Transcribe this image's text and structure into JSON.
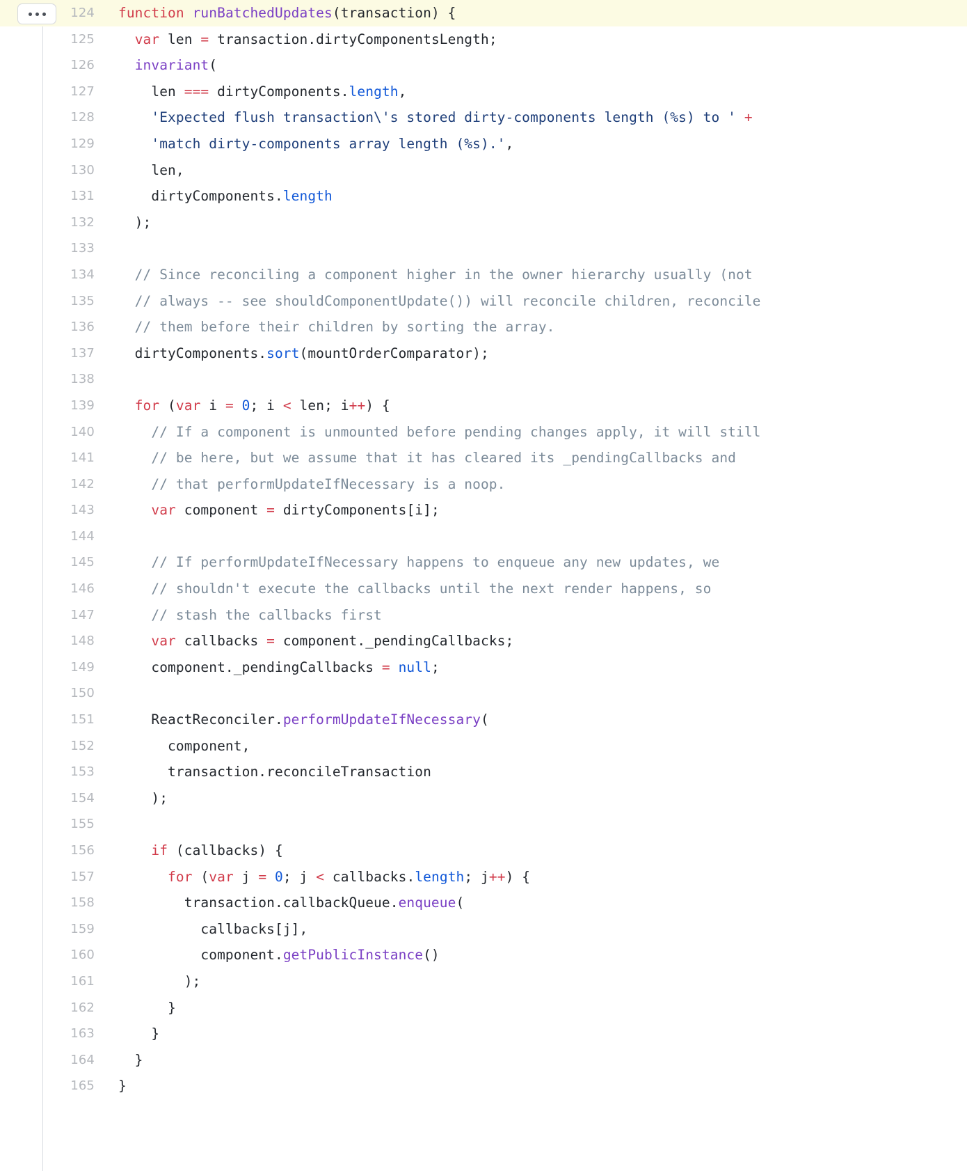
{
  "viewer": {
    "expand_button_label": "...",
    "first_line": 124,
    "last_line": 165,
    "highlighted_line": 124,
    "colors": {
      "background": "#ffffff",
      "highlight": "#fcfbe3",
      "gutter_rule": "#d8dbe0",
      "line_number": "#b5b8bd",
      "keyword": "#d13b4a",
      "function_name": "#7a3fc4",
      "string": "#1f3f7a",
      "comment": "#7c8b99",
      "property": "#1158d8",
      "plain": "#24282e"
    }
  },
  "lines": [
    {
      "n": "124",
      "highlighted": true,
      "tokens": [
        {
          "t": "function",
          "c": "t-kw"
        },
        {
          "t": " ",
          "c": "t-pln"
        },
        {
          "t": "runBatchedUpdates",
          "c": "t-fn"
        },
        {
          "t": "(transaction) {",
          "c": "t-pln"
        }
      ]
    },
    {
      "n": "125",
      "tokens": [
        {
          "t": "  ",
          "c": "t-pln"
        },
        {
          "t": "var",
          "c": "t-kw"
        },
        {
          "t": " len ",
          "c": "t-pln"
        },
        {
          "t": "=",
          "c": "t-op"
        },
        {
          "t": " transaction.dirtyComponentsLength;",
          "c": "t-pln"
        }
      ]
    },
    {
      "n": "126",
      "tokens": [
        {
          "t": "  ",
          "c": "t-pln"
        },
        {
          "t": "invariant",
          "c": "t-fn"
        },
        {
          "t": "(",
          "c": "t-pln"
        }
      ]
    },
    {
      "n": "127",
      "tokens": [
        {
          "t": "    len ",
          "c": "t-pln"
        },
        {
          "t": "===",
          "c": "t-op"
        },
        {
          "t": " dirtyComponents.",
          "c": "t-pln"
        },
        {
          "t": "length",
          "c": "t-prop"
        },
        {
          "t": ",",
          "c": "t-pln"
        }
      ]
    },
    {
      "n": "128",
      "tokens": [
        {
          "t": "    ",
          "c": "t-pln"
        },
        {
          "t": "'Expected flush transaction\\'s stored dirty-components length (%s) to '",
          "c": "t-str"
        },
        {
          "t": " ",
          "c": "t-pln"
        },
        {
          "t": "+",
          "c": "t-op"
        }
      ]
    },
    {
      "n": "129",
      "tokens": [
        {
          "t": "    ",
          "c": "t-pln"
        },
        {
          "t": "'match dirty-components array length (%s).'",
          "c": "t-str"
        },
        {
          "t": ",",
          "c": "t-pln"
        }
      ]
    },
    {
      "n": "130",
      "tokens": [
        {
          "t": "    len,",
          "c": "t-pln"
        }
      ]
    },
    {
      "n": "131",
      "tokens": [
        {
          "t": "    dirtyComponents.",
          "c": "t-pln"
        },
        {
          "t": "length",
          "c": "t-prop"
        }
      ]
    },
    {
      "n": "132",
      "tokens": [
        {
          "t": "  );",
          "c": "t-pln"
        }
      ]
    },
    {
      "n": "133",
      "tokens": [
        {
          "t": "",
          "c": "t-pln"
        }
      ]
    },
    {
      "n": "134",
      "tokens": [
        {
          "t": "  // Since reconciling a component higher in the owner hierarchy usually (not",
          "c": "t-com"
        }
      ]
    },
    {
      "n": "135",
      "tokens": [
        {
          "t": "  // always -- see shouldComponentUpdate()) will reconcile children, reconcile",
          "c": "t-com"
        }
      ]
    },
    {
      "n": "136",
      "tokens": [
        {
          "t": "  // them before their children by sorting the array.",
          "c": "t-com"
        }
      ]
    },
    {
      "n": "137",
      "tokens": [
        {
          "t": "  dirtyComponents.",
          "c": "t-pln"
        },
        {
          "t": "sort",
          "c": "t-prop"
        },
        {
          "t": "(mountOrderComparator);",
          "c": "t-pln"
        }
      ]
    },
    {
      "n": "138",
      "tokens": [
        {
          "t": "",
          "c": "t-pln"
        }
      ]
    },
    {
      "n": "139",
      "tokens": [
        {
          "t": "  ",
          "c": "t-pln"
        },
        {
          "t": "for",
          "c": "t-kw"
        },
        {
          "t": " (",
          "c": "t-pln"
        },
        {
          "t": "var",
          "c": "t-kw"
        },
        {
          "t": " i ",
          "c": "t-pln"
        },
        {
          "t": "=",
          "c": "t-op"
        },
        {
          "t": " ",
          "c": "t-pln"
        },
        {
          "t": "0",
          "c": "t-num"
        },
        {
          "t": "; i ",
          "c": "t-pln"
        },
        {
          "t": "<",
          "c": "t-op"
        },
        {
          "t": " len; i",
          "c": "t-pln"
        },
        {
          "t": "++",
          "c": "t-op"
        },
        {
          "t": ") {",
          "c": "t-pln"
        }
      ]
    },
    {
      "n": "140",
      "tokens": [
        {
          "t": "    // If a component is unmounted before pending changes apply, it will still",
          "c": "t-com"
        }
      ]
    },
    {
      "n": "141",
      "tokens": [
        {
          "t": "    // be here, but we assume that it has cleared its _pendingCallbacks and",
          "c": "t-com"
        }
      ]
    },
    {
      "n": "142",
      "tokens": [
        {
          "t": "    // that performUpdateIfNecessary is a noop.",
          "c": "t-com"
        }
      ]
    },
    {
      "n": "143",
      "tokens": [
        {
          "t": "    ",
          "c": "t-pln"
        },
        {
          "t": "var",
          "c": "t-kw"
        },
        {
          "t": " component ",
          "c": "t-pln"
        },
        {
          "t": "=",
          "c": "t-op"
        },
        {
          "t": " dirtyComponents[i];",
          "c": "t-pln"
        }
      ]
    },
    {
      "n": "144",
      "tokens": [
        {
          "t": "",
          "c": "t-pln"
        }
      ]
    },
    {
      "n": "145",
      "tokens": [
        {
          "t": "    // If performUpdateIfNecessary happens to enqueue any new updates, we",
          "c": "t-com"
        }
      ]
    },
    {
      "n": "146",
      "tokens": [
        {
          "t": "    // shouldn't execute the callbacks until the next render happens, so",
          "c": "t-com"
        }
      ]
    },
    {
      "n": "147",
      "tokens": [
        {
          "t": "    // stash the callbacks first",
          "c": "t-com"
        }
      ]
    },
    {
      "n": "148",
      "tokens": [
        {
          "t": "    ",
          "c": "t-pln"
        },
        {
          "t": "var",
          "c": "t-kw"
        },
        {
          "t": " callbacks ",
          "c": "t-pln"
        },
        {
          "t": "=",
          "c": "t-op"
        },
        {
          "t": " component._pendingCallbacks;",
          "c": "t-pln"
        }
      ]
    },
    {
      "n": "149",
      "tokens": [
        {
          "t": "    component._pendingCallbacks ",
          "c": "t-pln"
        },
        {
          "t": "=",
          "c": "t-op"
        },
        {
          "t": " ",
          "c": "t-pln"
        },
        {
          "t": "null",
          "c": "t-num"
        },
        {
          "t": ";",
          "c": "t-pln"
        }
      ]
    },
    {
      "n": "150",
      "tokens": [
        {
          "t": "",
          "c": "t-pln"
        }
      ]
    },
    {
      "n": "151",
      "tokens": [
        {
          "t": "    ReactReconciler.",
          "c": "t-pln"
        },
        {
          "t": "performUpdateIfNecessary",
          "c": "t-fn"
        },
        {
          "t": "(",
          "c": "t-pln"
        }
      ]
    },
    {
      "n": "152",
      "tokens": [
        {
          "t": "      component,",
          "c": "t-pln"
        }
      ]
    },
    {
      "n": "153",
      "tokens": [
        {
          "t": "      transaction.reconcileTransaction",
          "c": "t-pln"
        }
      ]
    },
    {
      "n": "154",
      "tokens": [
        {
          "t": "    );",
          "c": "t-pln"
        }
      ]
    },
    {
      "n": "155",
      "tokens": [
        {
          "t": "",
          "c": "t-pln"
        }
      ]
    },
    {
      "n": "156",
      "tokens": [
        {
          "t": "    ",
          "c": "t-pln"
        },
        {
          "t": "if",
          "c": "t-kw"
        },
        {
          "t": " (callbacks) {",
          "c": "t-pln"
        }
      ]
    },
    {
      "n": "157",
      "tokens": [
        {
          "t": "      ",
          "c": "t-pln"
        },
        {
          "t": "for",
          "c": "t-kw"
        },
        {
          "t": " (",
          "c": "t-pln"
        },
        {
          "t": "var",
          "c": "t-kw"
        },
        {
          "t": " j ",
          "c": "t-pln"
        },
        {
          "t": "=",
          "c": "t-op"
        },
        {
          "t": " ",
          "c": "t-pln"
        },
        {
          "t": "0",
          "c": "t-num"
        },
        {
          "t": "; j ",
          "c": "t-pln"
        },
        {
          "t": "<",
          "c": "t-op"
        },
        {
          "t": " callbacks.",
          "c": "t-pln"
        },
        {
          "t": "length",
          "c": "t-prop"
        },
        {
          "t": "; j",
          "c": "t-pln"
        },
        {
          "t": "++",
          "c": "t-op"
        },
        {
          "t": ") {",
          "c": "t-pln"
        }
      ]
    },
    {
      "n": "158",
      "tokens": [
        {
          "t": "        transaction.callbackQueue.",
          "c": "t-pln"
        },
        {
          "t": "enqueue",
          "c": "t-fn"
        },
        {
          "t": "(",
          "c": "t-pln"
        }
      ]
    },
    {
      "n": "159",
      "tokens": [
        {
          "t": "          callbacks[j],",
          "c": "t-pln"
        }
      ]
    },
    {
      "n": "160",
      "tokens": [
        {
          "t": "          component.",
          "c": "t-pln"
        },
        {
          "t": "getPublicInstance",
          "c": "t-fn"
        },
        {
          "t": "()",
          "c": "t-pln"
        }
      ]
    },
    {
      "n": "161",
      "tokens": [
        {
          "t": "        );",
          "c": "t-pln"
        }
      ]
    },
    {
      "n": "162",
      "tokens": [
        {
          "t": "      }",
          "c": "t-pln"
        }
      ]
    },
    {
      "n": "163",
      "tokens": [
        {
          "t": "    }",
          "c": "t-pln"
        }
      ]
    },
    {
      "n": "164",
      "tokens": [
        {
          "t": "  }",
          "c": "t-pln"
        }
      ]
    },
    {
      "n": "165",
      "tokens": [
        {
          "t": "}",
          "c": "t-pln"
        }
      ]
    }
  ]
}
